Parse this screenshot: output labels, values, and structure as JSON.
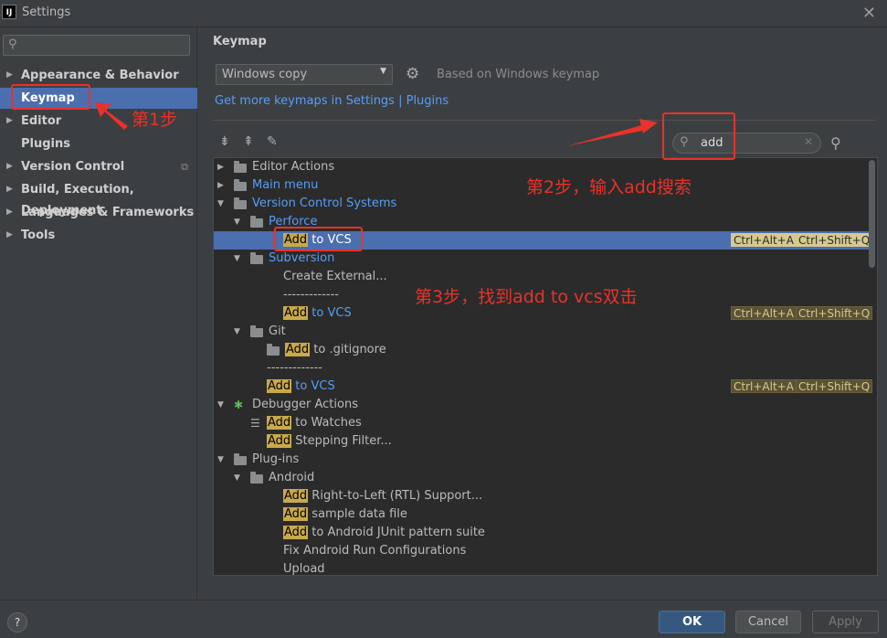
{
  "window": {
    "title": "Settings",
    "icon_text": "IJ"
  },
  "sidebar": {
    "search_placeholder": "",
    "items": [
      {
        "label": "Appearance & Behavior",
        "expandable": true
      },
      {
        "label": "Keymap",
        "expandable": false,
        "selected": true
      },
      {
        "label": "Editor",
        "expandable": true
      },
      {
        "label": "Plugins",
        "expandable": false
      },
      {
        "label": "Version Control",
        "expandable": true
      },
      {
        "label": "Build, Execution, Deployment",
        "expandable": true
      },
      {
        "label": "Languages & Frameworks",
        "expandable": true
      },
      {
        "label": "Tools",
        "expandable": true
      }
    ]
  },
  "main": {
    "heading": "Keymap",
    "keymap_value": "Windows copy",
    "based_on": "Based on Windows keymap",
    "more_link": "Get more keymaps in Settings | Plugins",
    "search_value": "add",
    "tree": [
      {
        "text": "Editor Actions",
        "depth": 0,
        "twisty": "closed",
        "icon": "folder"
      },
      {
        "text": "Main menu",
        "depth": 0,
        "twisty": "closed",
        "icon": "folder",
        "blue": true
      },
      {
        "text": "Version Control Systems",
        "depth": 0,
        "twisty": "open",
        "icon": "folder",
        "blue": true
      },
      {
        "text": "Perforce",
        "depth": 1,
        "twisty": "open",
        "icon": "folder",
        "blue": true
      },
      {
        "hl": "Add",
        "text": " to VCS",
        "depth": 3,
        "selected": true,
        "shortcuts": [
          "Ctrl+Alt+A",
          "Ctrl+Shift+Q"
        ]
      },
      {
        "text": "Subversion",
        "depth": 1,
        "twisty": "open",
        "icon": "folder",
        "blue": true
      },
      {
        "text": "Create External...",
        "depth": 3
      },
      {
        "text": "-------------",
        "depth": 3
      },
      {
        "hl": "Add",
        "text": " to VCS",
        "depth": 3,
        "blue": true,
        "shortcuts": [
          "Ctrl+Alt+A",
          "Ctrl+Shift+Q"
        ]
      },
      {
        "text": "Git",
        "depth": 1,
        "twisty": "open",
        "icon": "folder"
      },
      {
        "hl": "Add",
        "text": " to .gitignore",
        "depth": 2,
        "icon": "folder"
      },
      {
        "text": "-------------",
        "depth": 2
      },
      {
        "hl": "Add",
        "text": " to VCS",
        "depth": 2,
        "blue": true,
        "shortcuts": [
          "Ctrl+Alt+A",
          "Ctrl+Shift+Q"
        ]
      },
      {
        "text": "Debugger Actions",
        "depth": 0,
        "twisty": "open",
        "icon": "bug"
      },
      {
        "hl": "Add",
        "text": " to Watches",
        "depth": 2,
        "icon": "watch"
      },
      {
        "hl": "Add",
        "text": " Stepping Filter...",
        "depth": 2
      },
      {
        "text": "Plug-ins",
        "depth": 0,
        "twisty": "open",
        "icon": "folder"
      },
      {
        "text": "Android",
        "depth": 1,
        "twisty": "open",
        "icon": "folder"
      },
      {
        "hl": "Add",
        "text": " Right-to-Left (RTL) Support...",
        "depth": 3
      },
      {
        "hl": "Add",
        "text": " sample data file",
        "depth": 3
      },
      {
        "hl": "Add",
        "text": " to Android JUnit pattern suite",
        "depth": 3
      },
      {
        "text": "Fix Android Run Configurations",
        "depth": 3
      },
      {
        "text": "Upload",
        "depth": 3
      }
    ]
  },
  "annotations": {
    "step1": "第1步",
    "step2": "第2步，输入add搜索",
    "step3": "第3步，找到add to vcs双击"
  },
  "buttons": {
    "help": "?",
    "ok": "OK",
    "cancel": "Cancel",
    "apply": "Apply"
  },
  "colors": {
    "accent": "#4b6eaf",
    "annotation": "#e8322b",
    "highlight": "#c9a94a",
    "link": "#589df6"
  }
}
